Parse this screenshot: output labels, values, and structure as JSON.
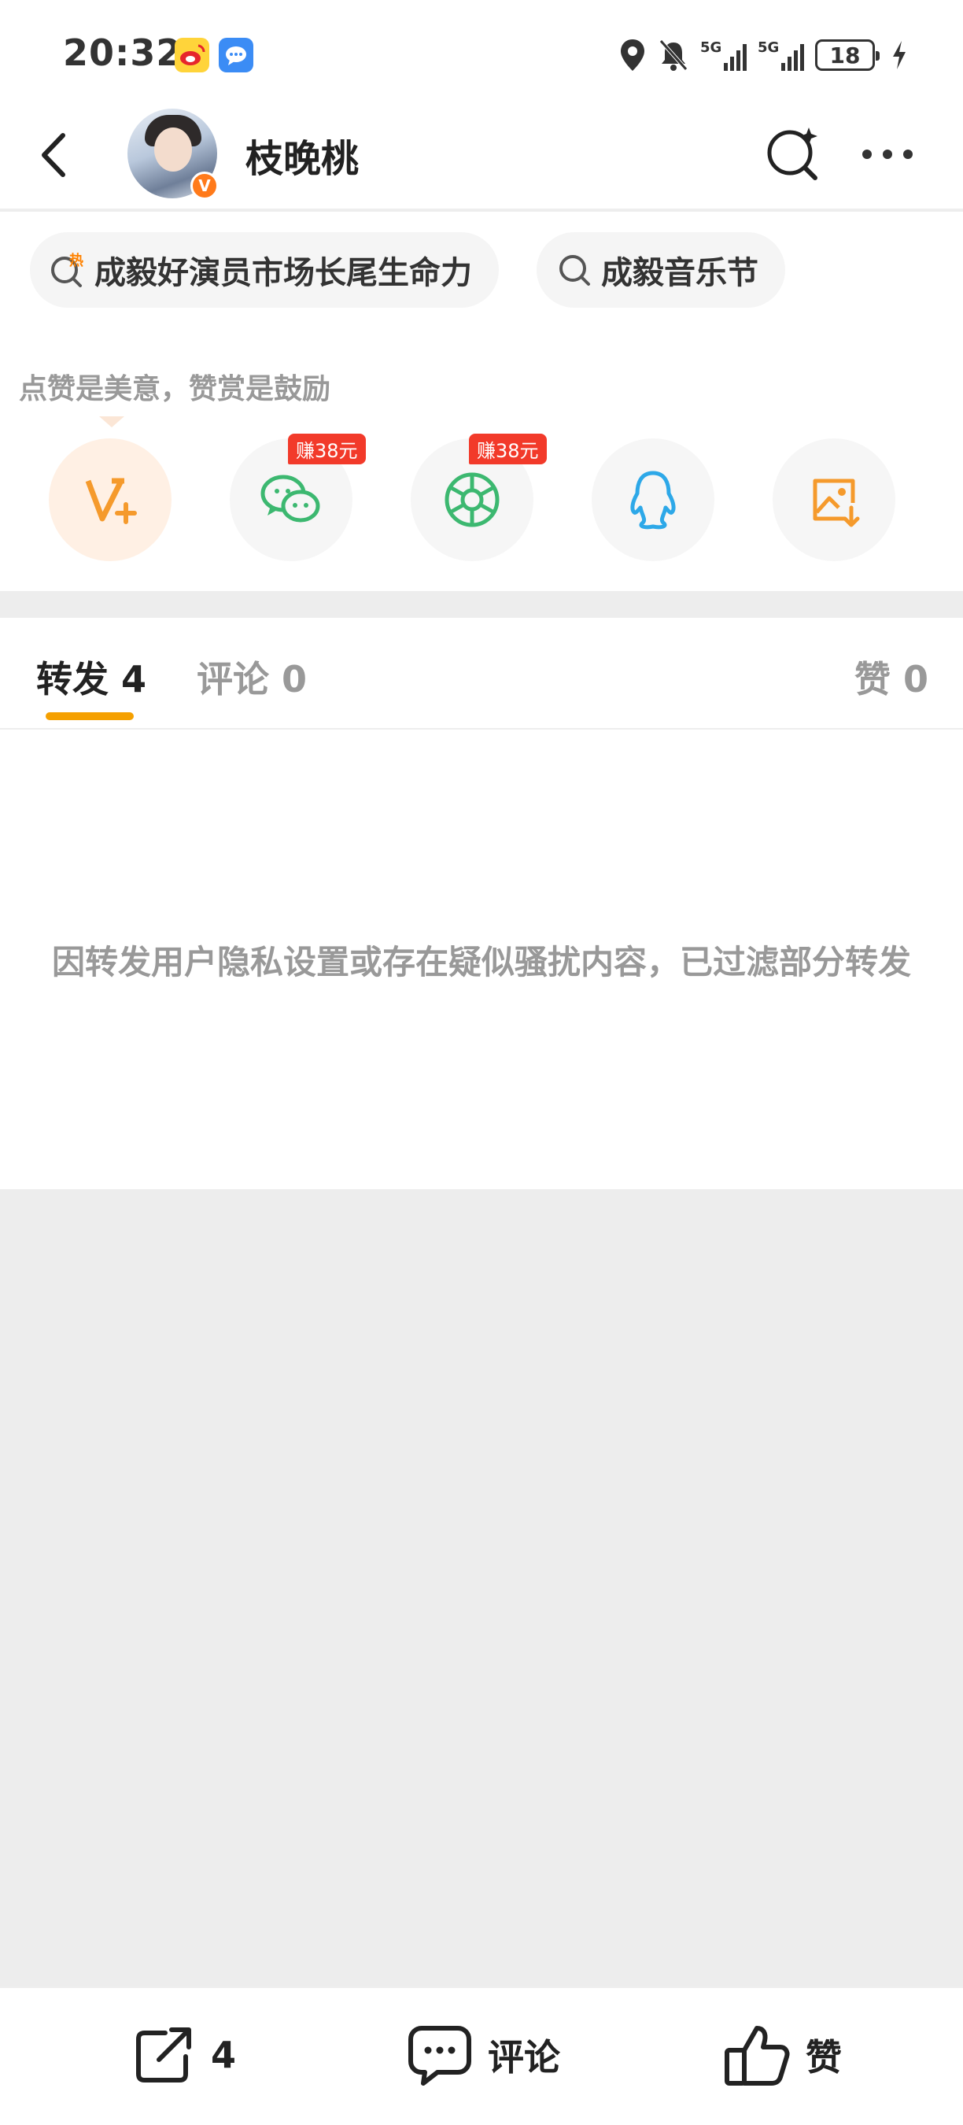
{
  "status_bar": {
    "time": "20:32",
    "network_1": "5G",
    "network_2": "5G",
    "battery": "18"
  },
  "header": {
    "username": "枝晚桃",
    "verified_badge": "V"
  },
  "topics": [
    {
      "label": "成毅好演员市场长尾生命力",
      "icon": "hot-search-icon",
      "hot_mark": "热"
    },
    {
      "label": "成毅音乐节",
      "icon": "search-icon"
    }
  ],
  "share": {
    "encourage_text": "点赞是美意，赞赏是鼓励",
    "items": [
      {
        "name": "weibo-vplus",
        "icon": "vplus-icon",
        "color": "#f59a2c"
      },
      {
        "name": "wechat",
        "icon": "wechat-icon",
        "color": "#3cb870",
        "earn_tag": "赚38元"
      },
      {
        "name": "moments",
        "icon": "moments-icon",
        "color": "#3cb870",
        "earn_tag": "赚38元"
      },
      {
        "name": "qq",
        "icon": "qq-icon",
        "color": "#2da8e8"
      },
      {
        "name": "save-image",
        "icon": "save-image-icon",
        "color": "#f59a2c"
      }
    ]
  },
  "tabs": {
    "repost": {
      "label": "转发",
      "count": "4"
    },
    "comment": {
      "label": "评论",
      "count": "0"
    },
    "like": {
      "label": "赞",
      "count": "0"
    },
    "accent": "#f5a000"
  },
  "notice": "因转发用户隐私设置或存在疑似骚扰内容，已过滤部分转发",
  "bottom_bar": {
    "repost_count": "4",
    "comment_label": "评论",
    "like_label": "赞"
  }
}
